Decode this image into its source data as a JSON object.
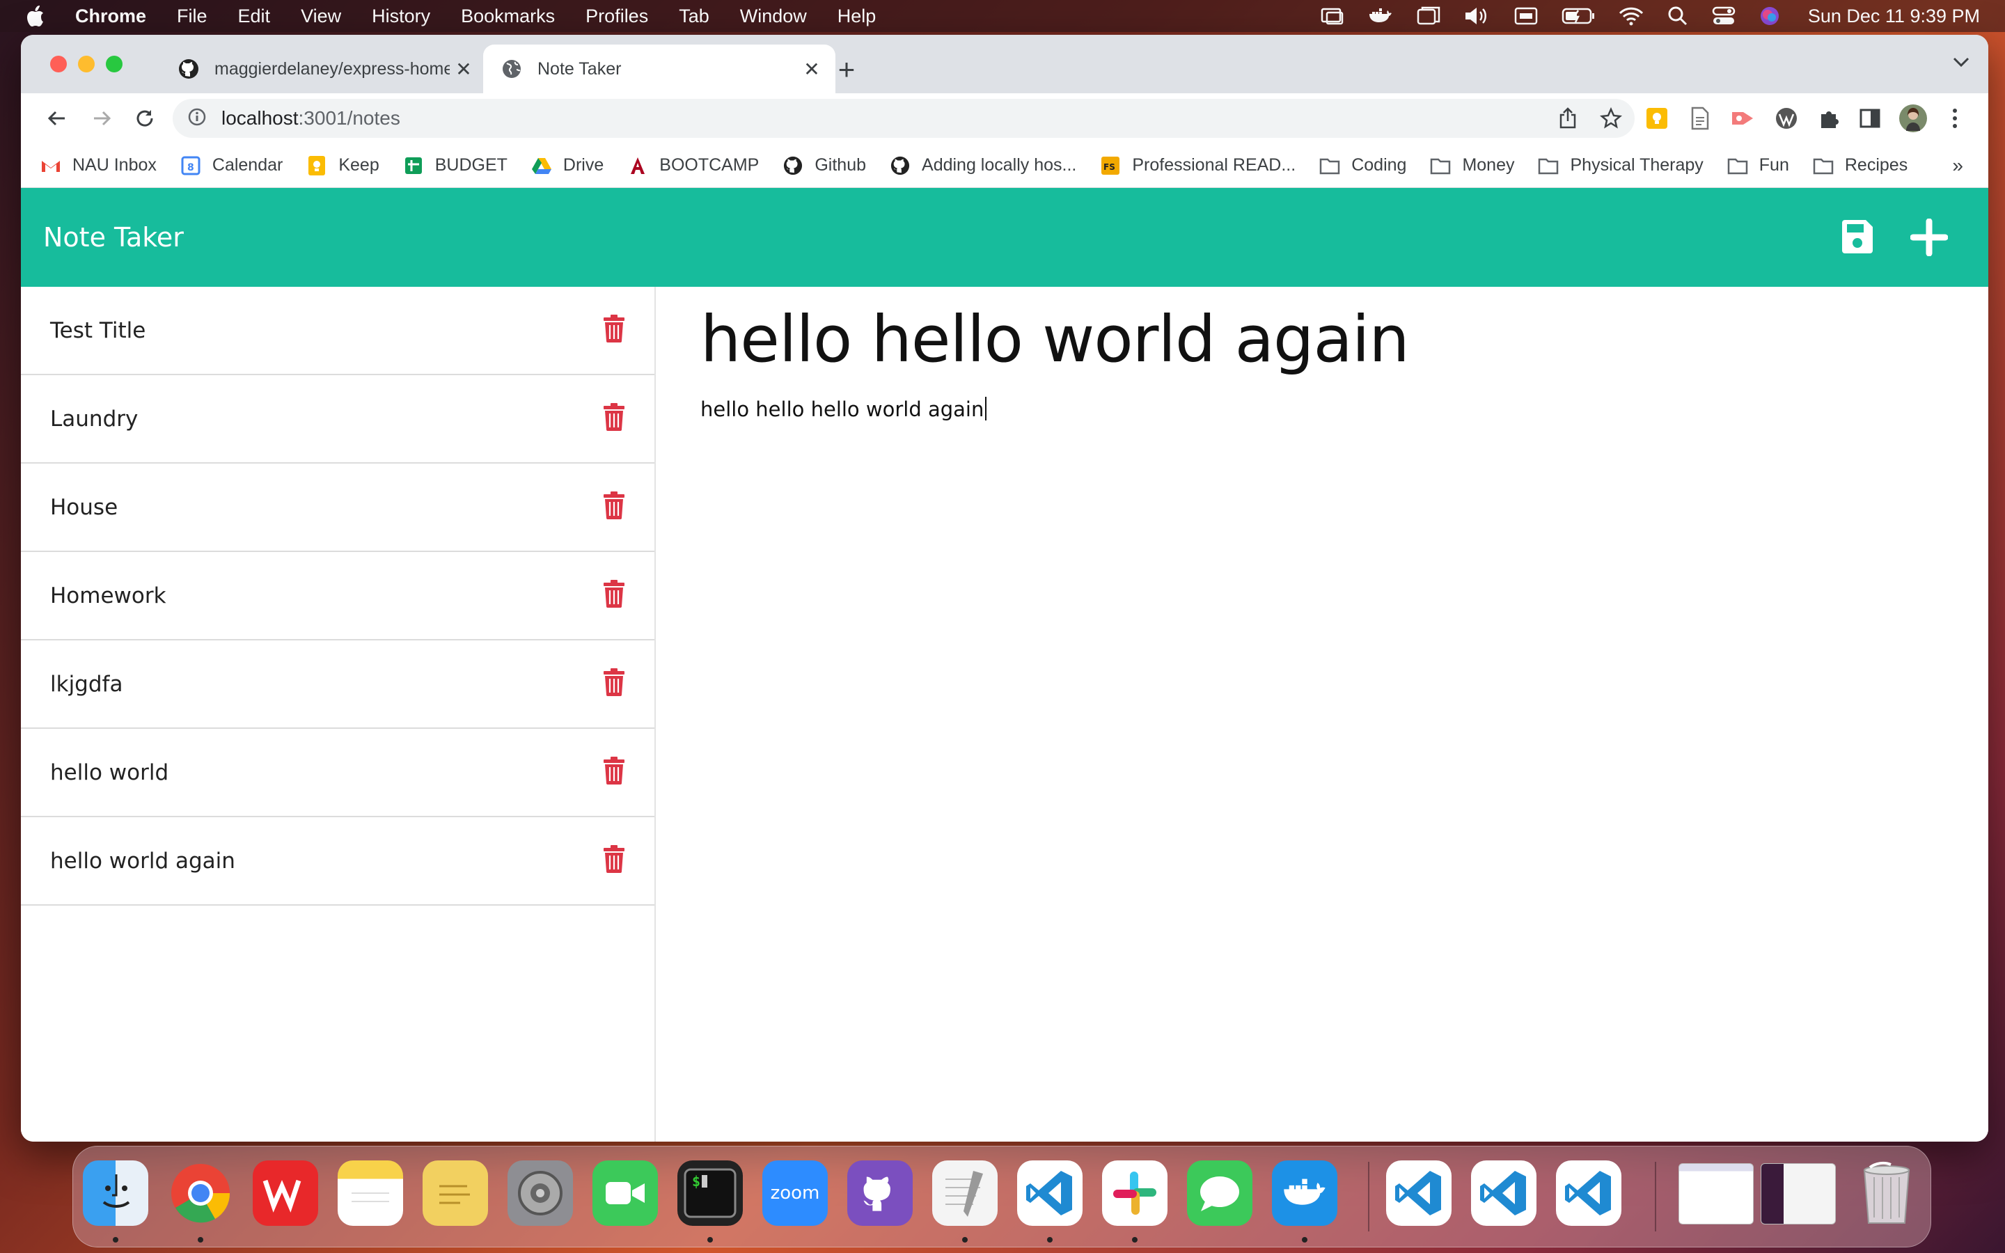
{
  "menubar": {
    "app": "Chrome",
    "items": [
      "File",
      "Edit",
      "View",
      "History",
      "Bookmarks",
      "Profiles",
      "Tab",
      "Window",
      "Help"
    ],
    "clock": "Sun Dec 11  9:39 PM"
  },
  "tabs": [
    {
      "label": "maggierdelaney/express-home",
      "icon": "github-icon"
    },
    {
      "label": "Note Taker",
      "icon": "globe-icon"
    }
  ],
  "omnibox": {
    "host": "localhost",
    "path": ":3001/notes"
  },
  "bookmarks": [
    {
      "label": "NAU Inbox",
      "icon": "gmail-icon",
      "color": "#ea4335"
    },
    {
      "label": "Calendar",
      "icon": "calendar-icon",
      "color": "#4285f4"
    },
    {
      "label": "Keep",
      "icon": "keep-icon",
      "color": "#fbbc04"
    },
    {
      "label": "BUDGET",
      "icon": "sheets-icon",
      "color": "#0f9d58"
    },
    {
      "label": "Drive",
      "icon": "drive-icon",
      "color": "#4285f4"
    },
    {
      "label": "BOOTCAMP",
      "icon": "arizona-icon",
      "color": "#ab0520"
    },
    {
      "label": "Github",
      "icon": "github-icon",
      "color": "#222222"
    },
    {
      "label": "Adding locally hos...",
      "icon": "github-icon",
      "color": "#222222"
    },
    {
      "label": "Professional READ...",
      "icon": "fs-icon",
      "color": "#f2a900"
    },
    {
      "label": "Coding",
      "icon": "folder-icon",
      "color": "#5f6368"
    },
    {
      "label": "Money",
      "icon": "folder-icon",
      "color": "#5f6368"
    },
    {
      "label": "Physical Therapy",
      "icon": "folder-icon",
      "color": "#5f6368"
    },
    {
      "label": "Fun",
      "icon": "folder-icon",
      "color": "#5f6368"
    },
    {
      "label": "Recipes",
      "icon": "folder-icon",
      "color": "#5f6368"
    }
  ],
  "bookmarks_more": "»",
  "app": {
    "brand": "Note Taker",
    "accent": "#17bc9c",
    "trash_color": "#dc3545",
    "notes": [
      "Test Title",
      "Laundry",
      "House",
      "Homework",
      "lkjgdfa",
      "hello world",
      "hello world again"
    ],
    "active_note": {
      "title": "hello hello world again",
      "text": "hello hello hello world again"
    }
  },
  "dock": [
    "finder",
    "chrome",
    "wps",
    "notes",
    "stickies",
    "system-preferences",
    "facetime",
    "terminal",
    "zoom",
    "github-desktop",
    "textedit",
    "vscode",
    "slack",
    "messages",
    "docker",
    "vscode",
    "vscode",
    "vscode"
  ],
  "dock_zoom_label": "zoom"
}
